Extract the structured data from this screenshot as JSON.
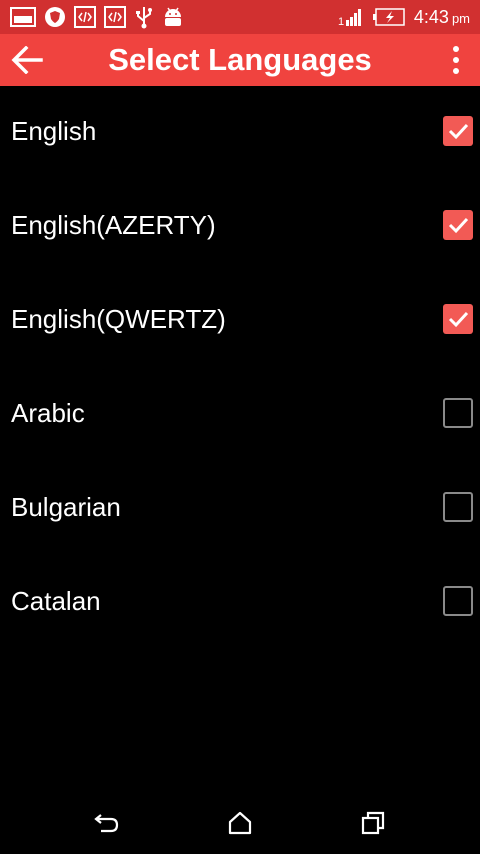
{
  "status_bar": {
    "time": "4:43",
    "ampm": "pm",
    "left_icons": [
      "gallery-icon",
      "shield-icon",
      "code-icon",
      "code-icon",
      "usb-icon",
      "android-icon"
    ],
    "right_icons": [
      "signal-icon",
      "battery-charging-icon"
    ]
  },
  "app_bar": {
    "title": "Select Languages",
    "back_icon": "arrow-back-icon",
    "menu_icon": "more-vert-icon",
    "color": "#f0433f"
  },
  "languages": [
    {
      "label": "English",
      "checked": true
    },
    {
      "label": "English(AZERTY)",
      "checked": true
    },
    {
      "label": "English(QWERTZ)",
      "checked": true
    },
    {
      "label": "Arabic",
      "checked": false
    },
    {
      "label": "Bulgarian",
      "checked": false
    },
    {
      "label": "Catalan",
      "checked": false
    }
  ],
  "nav_bar": {
    "back_icon": "nav-back-icon",
    "home_icon": "nav-home-icon",
    "recents_icon": "nav-recents-icon"
  },
  "colors": {
    "status_bar": "#d13030",
    "accent": "#f25a55",
    "background": "#000000"
  }
}
